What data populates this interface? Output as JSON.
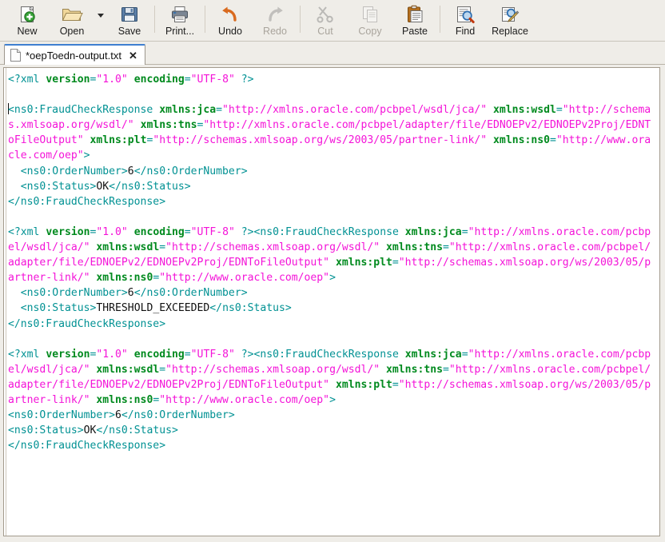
{
  "toolbar": {
    "items": [
      {
        "id": "new",
        "label": "New",
        "icon": "new-document-icon",
        "enabled": true
      },
      {
        "id": "open",
        "label": "Open",
        "icon": "open-folder-icon",
        "enabled": true
      },
      {
        "id": "save",
        "label": "Save",
        "icon": "floppy-save-icon",
        "enabled": true
      },
      {
        "id": "print",
        "label": "Print...",
        "icon": "printer-icon",
        "enabled": true
      },
      {
        "id": "undo",
        "label": "Undo",
        "icon": "undo-arrow-icon",
        "enabled": true
      },
      {
        "id": "redo",
        "label": "Redo",
        "icon": "redo-arrow-icon",
        "enabled": false
      },
      {
        "id": "cut",
        "label": "Cut",
        "icon": "scissors-icon",
        "enabled": false
      },
      {
        "id": "copy",
        "label": "Copy",
        "icon": "copy-pages-icon",
        "enabled": false
      },
      {
        "id": "paste",
        "label": "Paste",
        "icon": "clipboard-paste-icon",
        "enabled": true
      },
      {
        "id": "find",
        "label": "Find",
        "icon": "magnifier-find-icon",
        "enabled": true
      },
      {
        "id": "replace",
        "label": "Replace",
        "icon": "replace-pencil-icon",
        "enabled": true
      }
    ],
    "open_dropdown_icon": "chevron-down-icon"
  },
  "tabs": [
    {
      "label": "*oepToedn-output.txt",
      "modified": true,
      "active": true,
      "close_label": "✕",
      "file_icon": "text-file-icon"
    }
  ],
  "colors": {
    "toolbar_bg": "#efedE8",
    "editor_bg": "#ffffff",
    "tag": "#009193",
    "attribute_name": "#008a1e",
    "attribute_value": "#f413d8",
    "text_content": "#101010",
    "active_tab_accent": "#3f7fd0",
    "frame_border": "#a39b8d"
  },
  "document": {
    "filename": "*oepToedn-output.txt",
    "language": "xml",
    "cursor_line": 3,
    "blocks": [
      {
        "id": "block-1",
        "declaration_inline": false,
        "indented_children": true,
        "status": "OK",
        "order_number": "6"
      },
      {
        "id": "block-2",
        "declaration_inline": true,
        "indented_children": true,
        "status": "THRESHOLD_EXCEEDED",
        "order_number": "6"
      },
      {
        "id": "block-3",
        "declaration_inline": true,
        "indented_children": false,
        "status": "OK",
        "order_number": "6"
      }
    ],
    "xml_declaration": {
      "open": "<?xml",
      "attr_version": "version",
      "val_version": "\"1.0\"",
      "attr_encoding": "encoding",
      "val_encoding": "\"UTF-8\"",
      "close": "?>"
    },
    "root_element": {
      "open_tag": "<ns0:FraudCheckResponse",
      "close_tag": "</ns0:FraudCheckResponse>",
      "gt": ">"
    },
    "namespaces": [
      {
        "name": "xmlns:jca",
        "value": "\"http://xmlns.oracle.com/pcbpel/wsdl/jca/\""
      },
      {
        "name": "xmlns:wsdl",
        "value": "\"http://schemas.xmlsoap.org/wsdl/\""
      },
      {
        "name": "xmlns:tns",
        "value": "\"http://xmlns.oracle.com/pcbpel/adapter/file/EDNOEPv2/EDNOEPv2Proj/EDNToFileOutput\""
      },
      {
        "name": "xmlns:plt",
        "value": "\"http://schemas.xmlsoap.org/ws/2003/05/partner-link/\""
      },
      {
        "name": "xmlns:ns0",
        "value": "\"http://www.oracle.com/oep\""
      }
    ],
    "children": {
      "order_open": "<ns0:OrderNumber>",
      "order_close": "</ns0:OrderNumber>",
      "status_open": "<ns0:Status>",
      "status_close": "</ns0:Status>"
    }
  }
}
